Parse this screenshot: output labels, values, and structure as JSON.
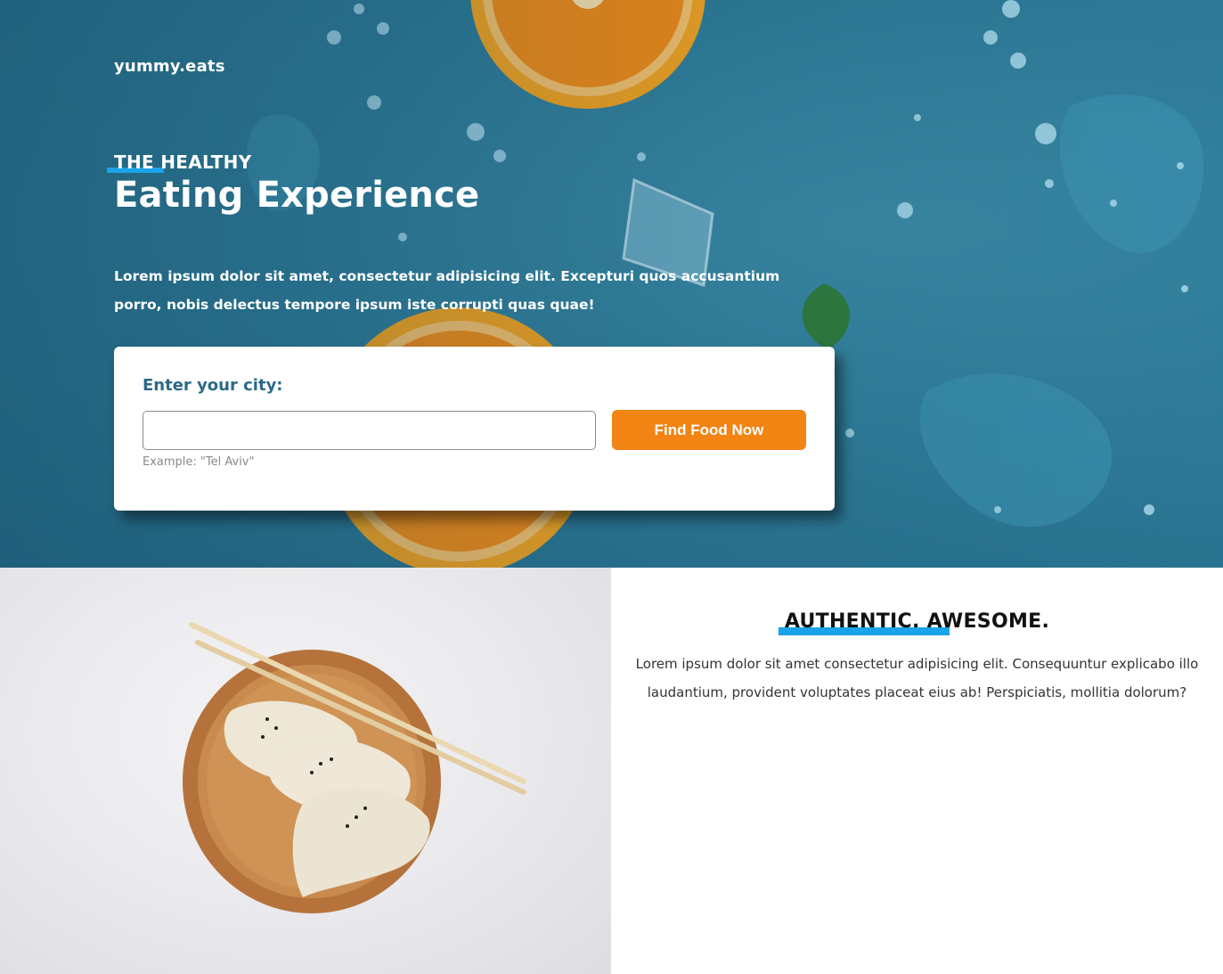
{
  "header": {
    "brand": "yummy.eats"
  },
  "hero": {
    "eyebrow": "THE HEALTHY",
    "headline": "Eating Experience",
    "intro": "Lorem ipsum dolor sit amet, consectetur adipisicing elit. Excepturi quos accusantium porro, nobis delectus tempore ipsum iste corrupti quas quae!"
  },
  "search": {
    "label": "Enter your city:",
    "input_value": "",
    "hint": "Example: \"Tel Aviv\"",
    "button_label": "Find Food Now"
  },
  "feature": {
    "title": "AUTHENTIC. AWESOME.",
    "text": "Lorem ipsum dolor sit amet consectetur adipisicing elit. Consequuntur explicabo illo laudantium, provident voluptates placeat eius ab! Perspiciatis, mollitia dolorum?"
  },
  "colors": {
    "hero_blue": "#2e7b98",
    "accent_blue": "#1aa3e8",
    "button_orange": "#f28413",
    "label_teal": "#2b6a86"
  }
}
